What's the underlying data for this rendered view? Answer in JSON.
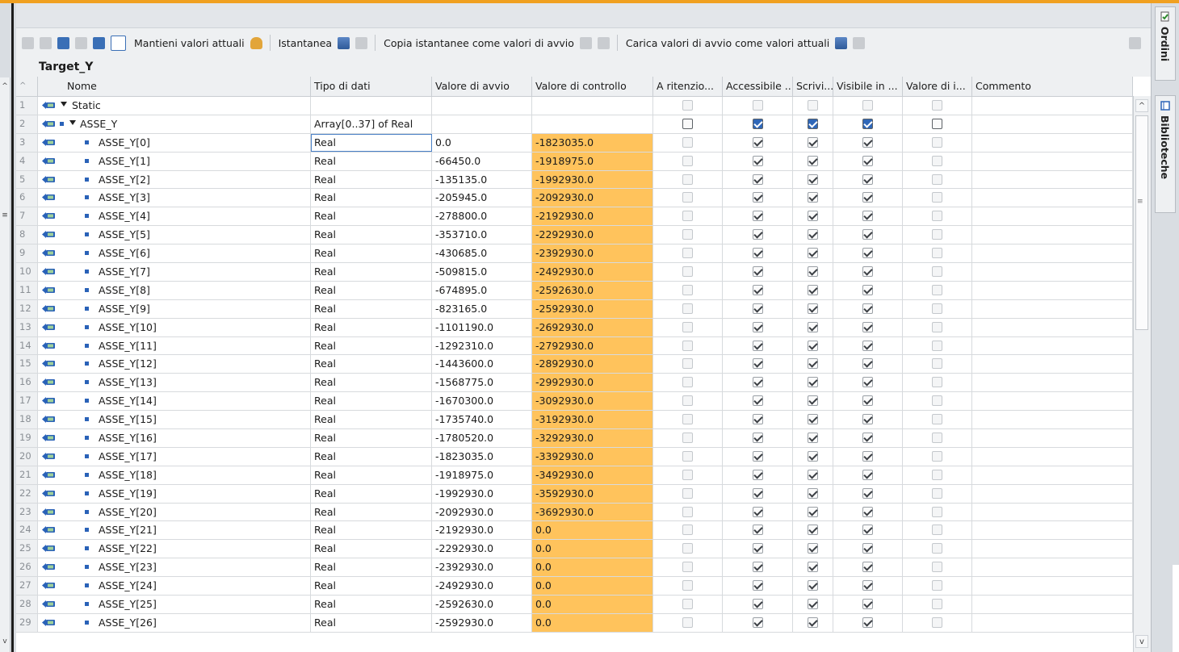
{
  "toolbar": {
    "keep_values_label": "Mantieni valori attuali",
    "snapshot_label": "Istantanea",
    "copy_snapshots_label": "Copia istantanee come valori di avvio",
    "load_start_values_label": "Carica valori di avvio come valori attuali"
  },
  "block_title": "Target_Y",
  "columns": {
    "name": "Nome",
    "type": "Tipo di dati",
    "start": "Valore di avvio",
    "control": "Valore di controllo",
    "retain": "A ritenzio...",
    "accessible": "Accessibile ...",
    "writable": "Scrivi...",
    "visible": "Visibile in ...",
    "setpoint": "Valore di i...",
    "comment": "Commento"
  },
  "side_tabs": {
    "orders": "Ordini",
    "libraries": "Biblioteche"
  },
  "rows": [
    {
      "num": "1",
      "name": "Static",
      "type": "",
      "start": "",
      "control": "",
      "level": 0,
      "expand": true,
      "checks": "none"
    },
    {
      "num": "2",
      "name": "ASSE_Y",
      "type": "Array[0..37] of Real",
      "start": "",
      "control": "",
      "level": 1,
      "expand": true,
      "checks": "parent"
    },
    {
      "num": "3",
      "name": "ASSE_Y[0]",
      "type": "Real",
      "start": "0.0",
      "control": "-1823035.0",
      "level": 2
    },
    {
      "num": "4",
      "name": "ASSE_Y[1]",
      "type": "Real",
      "start": "-66450.0",
      "control": "-1918975.0",
      "level": 2
    },
    {
      "num": "5",
      "name": "ASSE_Y[2]",
      "type": "Real",
      "start": "-135135.0",
      "control": "-1992930.0",
      "level": 2
    },
    {
      "num": "6",
      "name": "ASSE_Y[3]",
      "type": "Real",
      "start": "-205945.0",
      "control": "-2092930.0",
      "level": 2
    },
    {
      "num": "7",
      "name": "ASSE_Y[4]",
      "type": "Real",
      "start": "-278800.0",
      "control": "-2192930.0",
      "level": 2
    },
    {
      "num": "8",
      "name": "ASSE_Y[5]",
      "type": "Real",
      "start": "-353710.0",
      "control": "-2292930.0",
      "level": 2
    },
    {
      "num": "9",
      "name": "ASSE_Y[6]",
      "type": "Real",
      "start": "-430685.0",
      "control": "-2392930.0",
      "level": 2
    },
    {
      "num": "10",
      "name": "ASSE_Y[7]",
      "type": "Real",
      "start": "-509815.0",
      "control": "-2492930.0",
      "level": 2
    },
    {
      "num": "11",
      "name": "ASSE_Y[8]",
      "type": "Real",
      "start": "-674895.0",
      "control": "-2592630.0",
      "level": 2
    },
    {
      "num": "12",
      "name": "ASSE_Y[9]",
      "type": "Real",
      "start": "-823165.0",
      "control": "-2592930.0",
      "level": 2
    },
    {
      "num": "13",
      "name": "ASSE_Y[10]",
      "type": "Real",
      "start": "-1101190.0",
      "control": "-2692930.0",
      "level": 2
    },
    {
      "num": "14",
      "name": "ASSE_Y[11]",
      "type": "Real",
      "start": "-1292310.0",
      "control": "-2792930.0",
      "level": 2
    },
    {
      "num": "15",
      "name": "ASSE_Y[12]",
      "type": "Real",
      "start": "-1443600.0",
      "control": "-2892930.0",
      "level": 2
    },
    {
      "num": "16",
      "name": "ASSE_Y[13]",
      "type": "Real",
      "start": "-1568775.0",
      "control": "-2992930.0",
      "level": 2
    },
    {
      "num": "17",
      "name": "ASSE_Y[14]",
      "type": "Real",
      "start": "-1670300.0",
      "control": "-3092930.0",
      "level": 2
    },
    {
      "num": "18",
      "name": "ASSE_Y[15]",
      "type": "Real",
      "start": "-1735740.0",
      "control": "-3192930.0",
      "level": 2
    },
    {
      "num": "19",
      "name": "ASSE_Y[16]",
      "type": "Real",
      "start": "-1780520.0",
      "control": "-3292930.0",
      "level": 2
    },
    {
      "num": "20",
      "name": "ASSE_Y[17]",
      "type": "Real",
      "start": "-1823035.0",
      "control": "-3392930.0",
      "level": 2
    },
    {
      "num": "21",
      "name": "ASSE_Y[18]",
      "type": "Real",
      "start": "-1918975.0",
      "control": "-3492930.0",
      "level": 2
    },
    {
      "num": "22",
      "name": "ASSE_Y[19]",
      "type": "Real",
      "start": "-1992930.0",
      "control": "-3592930.0",
      "level": 2
    },
    {
      "num": "23",
      "name": "ASSE_Y[20]",
      "type": "Real",
      "start": "-2092930.0",
      "control": "-3692930.0",
      "level": 2
    },
    {
      "num": "24",
      "name": "ASSE_Y[21]",
      "type": "Real",
      "start": "-2192930.0",
      "control": "0.0",
      "level": 2
    },
    {
      "num": "25",
      "name": "ASSE_Y[22]",
      "type": "Real",
      "start": "-2292930.0",
      "control": "0.0",
      "level": 2
    },
    {
      "num": "26",
      "name": "ASSE_Y[23]",
      "type": "Real",
      "start": "-2392930.0",
      "control": "0.0",
      "level": 2
    },
    {
      "num": "27",
      "name": "ASSE_Y[24]",
      "type": "Real",
      "start": "-2492930.0",
      "control": "0.0",
      "level": 2
    },
    {
      "num": "28",
      "name": "ASSE_Y[25]",
      "type": "Real",
      "start": "-2592630.0",
      "control": "0.0",
      "level": 2
    },
    {
      "num": "29",
      "name": "ASSE_Y[26]",
      "type": "Real",
      "start": "-2592930.0",
      "control": "0.0",
      "level": 2
    }
  ],
  "colors": {
    "accent": "#f0a020",
    "control_highlight": "#ffc35c",
    "checkbox_checked_parent": "#2f67b8"
  }
}
